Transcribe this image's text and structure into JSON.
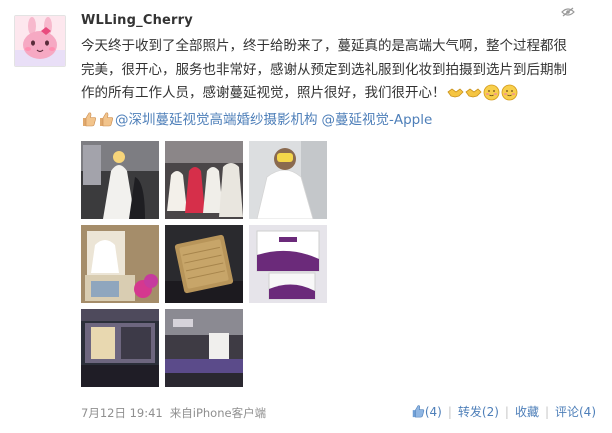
{
  "post": {
    "username": "WLLing_Cherry",
    "text": "今天终于收到了全部照片，终于给盼来了，蔓延真的是高端大气啊，整个过程都很完美，很开心，服务也非常好，感谢从预定到选礼服到化妆到拍摄到选片到后期制作的所有工作人员，感谢蔓延视觉，照片很好，我们很开心！",
    "emoji_icons": [
      "handshake-icon",
      "handshake-icon",
      "blush-face-icon",
      "blush-face-icon"
    ],
    "thumbs_icons": [
      "thumbs-up-icon",
      "thumbs-up-icon"
    ],
    "mention1": "@深圳蔓延视觉高端婚纱摄影机构",
    "mention2": "@蔓延视觉-Apple",
    "date": "7月12日 19:41",
    "source": "来自iPhone客户端",
    "hide_icon": "chevron-down-icon"
  },
  "actions": {
    "like_count": "(4)",
    "repost_label": "转发(2)",
    "favorite_label": "收藏",
    "comment_label": "评论(4)"
  },
  "photos": [
    {
      "label": "bride-fitting-photo"
    },
    {
      "label": "gown-showroom-photo"
    },
    {
      "label": "bride-selfie-photo"
    },
    {
      "label": "wedding-album-photo"
    },
    {
      "label": "gold-album-case-photo"
    },
    {
      "label": "studio-brochure-photo"
    },
    {
      "label": "studio-storefront-photo"
    },
    {
      "label": "studio-lounge-photo"
    }
  ],
  "colors": {
    "link": "#4e7fb9",
    "text": "#333333",
    "muted": "#8f8f8f",
    "brand_purple": "#6b2a7a"
  }
}
